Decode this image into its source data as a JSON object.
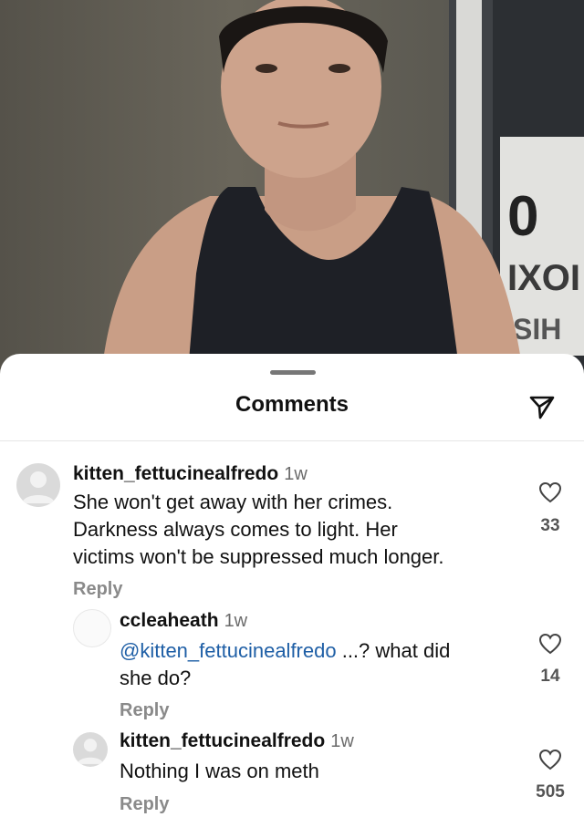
{
  "sheet": {
    "title": "Comments",
    "share_icon": "send-paper-plane-icon"
  },
  "comments": [
    {
      "username": "kitten_fettucinealfredo",
      "time": "1w",
      "lines": [
        "She won't get away with her crimes.",
        "Darkness always comes to light. Her",
        "victims won't be suppressed much longer."
      ],
      "reply_label": "Reply",
      "likes": "33"
    },
    {
      "username": "ccleaheath",
      "time": "1w",
      "mention": "@kitten_fettucinealfredo",
      "line1_rest": " ...? what did",
      "line2": "she do?",
      "reply_label": "Reply",
      "likes": "14"
    },
    {
      "username": "kitten_fettucinealfredo",
      "time": "1w",
      "lines": [
        "Nothing I was on meth"
      ],
      "reply_label": "Reply",
      "likes": "505"
    }
  ],
  "colors": {
    "mention": "#1f5fa6",
    "reply": "#8a8a8a",
    "count": "#555555"
  }
}
